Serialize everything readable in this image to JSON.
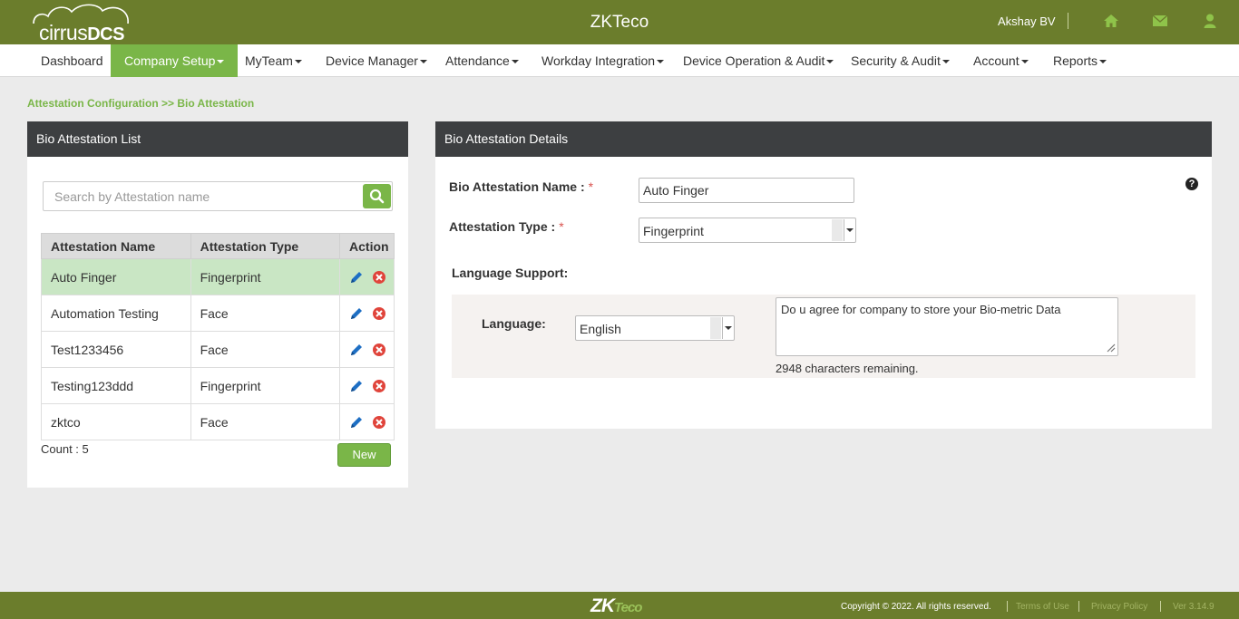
{
  "header": {
    "logo_text": "cirrus",
    "logo_bold": "DCS",
    "app_title": "ZKTeco",
    "user_name": "Akshay BV",
    "icons": [
      "home-icon",
      "envelope-icon",
      "user-icon"
    ]
  },
  "nav": {
    "items": [
      {
        "label": "Dashboard"
      },
      {
        "label": "Company Setup"
      },
      {
        "label": "MyTeam"
      },
      {
        "label": "Device Manager"
      },
      {
        "label": "Attendance"
      },
      {
        "label": "Workday Integration"
      },
      {
        "label": "Device Operation & Audit"
      },
      {
        "label": "Security & Audit"
      },
      {
        "label": "Account"
      },
      {
        "label": "Reports"
      }
    ],
    "active": "Company Setup"
  },
  "breadcrumb": "Attestation Configuration >> Bio Attestation",
  "list_panel": {
    "title": "Bio Attestation List",
    "search_placeholder": "Search by Attestation name",
    "columns": [
      "Attestation Name",
      "Attestation Type",
      "Action"
    ],
    "rows": [
      {
        "name": "Auto Finger",
        "type": "Fingerprint",
        "selected": true
      },
      {
        "name": "Automation Testing",
        "type": "Face"
      },
      {
        "name": "Test1233456",
        "type": "Face"
      },
      {
        "name": "Testing123ddd",
        "type": "Fingerprint"
      },
      {
        "name": "zktco",
        "type": "Face"
      }
    ],
    "count_text": "Count : 5",
    "new_button": "New"
  },
  "details_panel": {
    "title": "Bio Attestation Details",
    "name_label": "Bio Attestation Name :",
    "name_value": "Auto Finger",
    "type_label": "Attestation Type :",
    "type_value": "Fingerprint",
    "required_mark": "*",
    "language_support_label": "Language Support:",
    "language_label": "Language:",
    "language_value": "English",
    "message_text": "Do u agree for company to store your Bio-metric Data",
    "remaining_text": "2948 characters remaining.",
    "help_glyph": "?"
  },
  "footer": {
    "logo_main": "ZK",
    "logo_eco": "Teco",
    "copyright": "Copyright © 2022. All rights reserved.",
    "terms": "Terms of Use",
    "privacy": "Privacy Policy",
    "version": "Ver 3.14.9"
  },
  "colors": {
    "brand_olive": "#6b7d2c",
    "accent_green": "#7ab648",
    "panel_header": "#3d3f41",
    "selected_row": "#c9e6c4",
    "edit_blue": "#1e6fc4",
    "delete_red": "#e0443b"
  }
}
